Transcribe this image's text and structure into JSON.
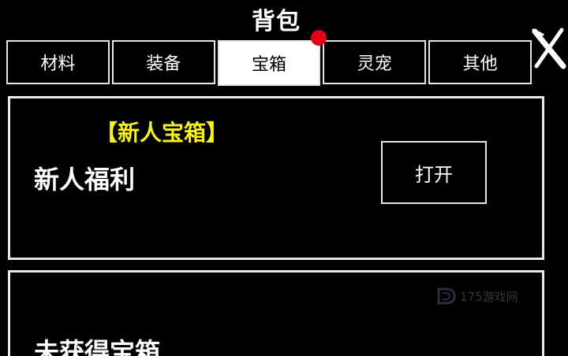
{
  "window": {
    "title": "背包"
  },
  "tabs": [
    {
      "label": "材料",
      "active": false
    },
    {
      "label": "装备",
      "active": false
    },
    {
      "label": "宝箱",
      "active": true
    },
    {
      "label": "灵宠",
      "active": false
    },
    {
      "label": "其他",
      "active": false
    }
  ],
  "colors": {
    "background": "#000000",
    "border": "#e8e8e8",
    "highlight_tag": "#f5f020",
    "badge": "#e3001b"
  },
  "icons": {
    "close": "close-icon",
    "badge": "notification-dot",
    "watermark": "site-logo-icon"
  },
  "chests": [
    {
      "tag": "【新人宝箱】",
      "name": "新人福利",
      "action_label": "打开"
    },
    {
      "name": "未获得宝箱"
    }
  ],
  "watermark": {
    "text": "175游戏网"
  }
}
